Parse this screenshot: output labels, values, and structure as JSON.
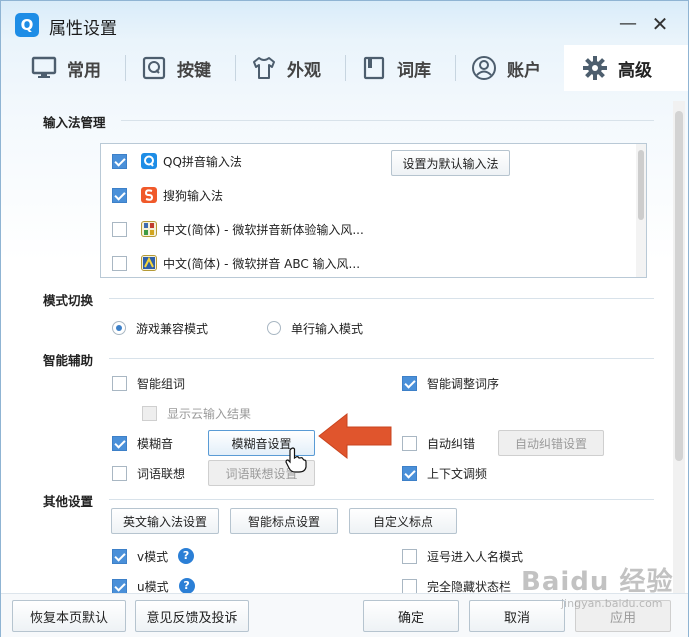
{
  "window": {
    "title": "属性设置",
    "minimize": "—",
    "close": "✕"
  },
  "tabs": [
    {
      "label": "常用",
      "icon": "monitor-icon"
    },
    {
      "label": "按键",
      "icon": "key-q-icon"
    },
    {
      "label": "外观",
      "icon": "shirt-icon"
    },
    {
      "label": "词库",
      "icon": "book-icon"
    },
    {
      "label": "账户",
      "icon": "user-icon"
    },
    {
      "label": "高级",
      "icon": "gear-icon",
      "active": true
    }
  ],
  "ime_section": {
    "title": "输入法管理",
    "items": [
      {
        "label": "QQ拼音输入法",
        "checked": true,
        "icon": "qq-pinyin-icon"
      },
      {
        "label": "搜狗输入法",
        "checked": true,
        "icon": "sogou-icon"
      },
      {
        "label": "中文(简体) - 微软拼音新体验输入风...",
        "checked": false,
        "icon": "ms-pinyin-icon"
      },
      {
        "label": "中文(简体) - 微软拼音 ABC 输入风...",
        "checked": false,
        "icon": "ms-abc-icon"
      }
    ],
    "set_default_label": "设置为默认输入法"
  },
  "mode_section": {
    "title": "模式切换",
    "options": [
      {
        "label": "游戏兼容模式",
        "selected": true
      },
      {
        "label": "单行输入模式",
        "selected": false
      }
    ]
  },
  "assist_section": {
    "title": "智能辅助",
    "smart_group": {
      "label": "智能组词",
      "checked": false
    },
    "cloud_result": {
      "label": "显示云输入结果",
      "checked": false
    },
    "smart_order": {
      "label": "智能调整词序",
      "checked": true
    },
    "fuzzy": {
      "label": "模糊音",
      "checked": true,
      "button": "模糊音设置"
    },
    "autocorrect": {
      "label": "自动纠错",
      "checked": false,
      "button": "自动纠错设置"
    },
    "association": {
      "label": "词语联想",
      "checked": false,
      "button": "词语联想设置"
    },
    "context": {
      "label": "上下文调频",
      "checked": true
    }
  },
  "other_section": {
    "title": "其他设置",
    "buttons": [
      "英文输入法设置",
      "智能标点设置",
      "自定义标点"
    ],
    "v_mode": {
      "label": "v模式",
      "checked": true
    },
    "u_mode": {
      "label": "u模式",
      "checked": true
    },
    "comma_names": {
      "label": "逗号进入人名模式",
      "checked": false
    },
    "hide_status": {
      "label": "完全隐藏状态栏",
      "checked": false
    },
    "help": "?"
  },
  "footer": {
    "restore": "恢复本页默认",
    "feedback": "意见反馈及投诉",
    "ok": "确定",
    "cancel": "取消",
    "apply": "应用"
  },
  "watermark": {
    "text": "Baidu 经验",
    "sub": "jingyan.baidu.com"
  },
  "colors": {
    "accent": "#4a90d9",
    "arrow": "#e0552d",
    "brand": "#1e8de6"
  }
}
